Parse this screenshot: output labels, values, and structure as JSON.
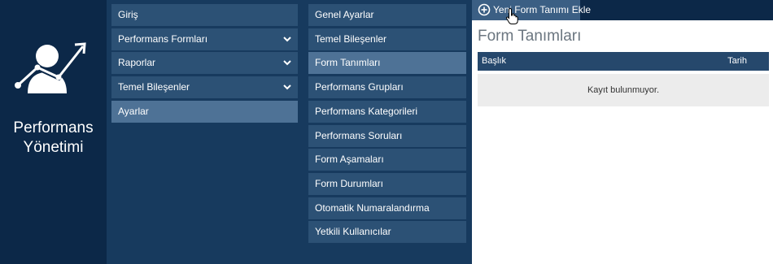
{
  "brand": {
    "icon": "performance-user-chart-icon",
    "title_line1": "Performans",
    "title_line2": "Yönetimi"
  },
  "main_menu": {
    "items": [
      {
        "label": "Giriş",
        "has_chevron": false,
        "active": false
      },
      {
        "label": "Performans Formları",
        "has_chevron": true,
        "active": false
      },
      {
        "label": "Raporlar",
        "has_chevron": true,
        "active": false
      },
      {
        "label": "Temel Bileşenler",
        "has_chevron": true,
        "active": false
      },
      {
        "label": "Ayarlar",
        "has_chevron": false,
        "active": true
      }
    ]
  },
  "settings_menu": {
    "items": [
      {
        "label": "Genel Ayarlar",
        "active": false
      },
      {
        "label": "Temel Bileşenler",
        "active": false
      },
      {
        "label": "Form Tanımları",
        "active": true
      },
      {
        "label": "Performans Grupları",
        "active": false
      },
      {
        "label": "Performans Kategorileri",
        "active": false
      },
      {
        "label": "Performans Soruları",
        "active": false
      },
      {
        "label": "Form Aşamaları",
        "active": false
      },
      {
        "label": "Form Durumları",
        "active": false
      },
      {
        "label": "Otomatik Numaralandırma",
        "active": false
      },
      {
        "label": "Yetkili Kullanıcılar",
        "active": false
      }
    ]
  },
  "toolbar": {
    "add_label": "Yeni Form Tanımı Ekle",
    "add_icon": "plus-circle-icon"
  },
  "content": {
    "title": "Form Tanımları",
    "table": {
      "columns": [
        "Başlık",
        "Tarih"
      ],
      "empty_text": "Kayıt bulunmuyor."
    }
  },
  "colors": {
    "brand_bg": "#0c2848",
    "menu_bg": "#173a5e",
    "item_bg": "#2c5175",
    "item_active_bg": "#4e7296",
    "table_header_bg": "#26486c"
  }
}
